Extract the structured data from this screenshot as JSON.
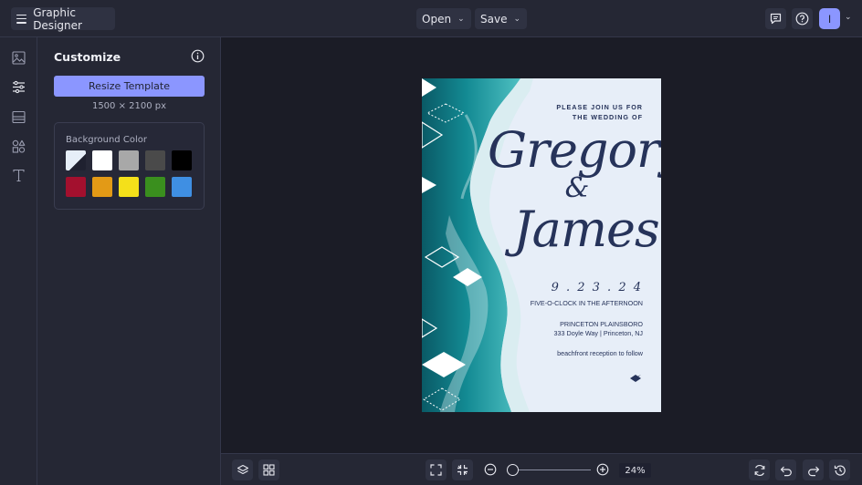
{
  "app": {
    "title": "Graphic Designer"
  },
  "topbar": {
    "open_label": "Open",
    "save_label": "Save",
    "avatar_initial": "I"
  },
  "panel": {
    "title": "Customize",
    "resize_label": "Resize Template",
    "dimensions": "1500 × 2100 px",
    "background_color_label": "Background Color",
    "swatches": [
      "#e6eef8",
      "#ffffff",
      "#a8a8a8",
      "#4a4a4a",
      "#000000",
      "#a3102e",
      "#e39a16",
      "#f4e01a",
      "#3a8f1e",
      "#3f8fe3"
    ]
  },
  "invitation": {
    "line1": "PLEASE JOIN US FOR",
    "line2": "THE WEDDING OF",
    "name1": "Gregory",
    "amp": "&",
    "name2": "James",
    "date": "9 . 2 3 . 2 4",
    "time": "FIVE-O-CLOCK IN THE AFTERNOON",
    "venue": "PRINCETON PLAINSBORO",
    "address": "333  Doyle Way | Princeton, NJ",
    "reception": "beachfront reception to follow"
  },
  "zoom": {
    "percent": "24%",
    "level": 0.24
  },
  "colors": {
    "accent": "#8b96ff",
    "ink": "#26335a",
    "teal": "#1a8c96"
  }
}
